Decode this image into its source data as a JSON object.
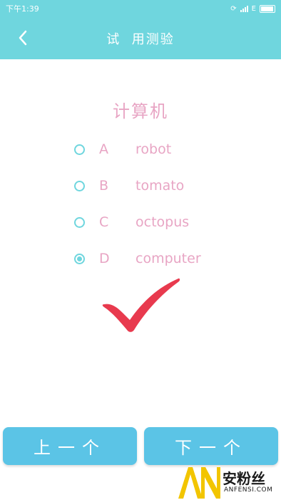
{
  "status_bar": {
    "time": "下午1:39",
    "network": "E"
  },
  "header": {
    "back_icon": "chevron-left-icon",
    "title": "试  用测验"
  },
  "question": {
    "word": "计算机"
  },
  "options": [
    {
      "letter": "A",
      "text": "robot",
      "selected": false
    },
    {
      "letter": "B",
      "text": "tomato",
      "selected": false
    },
    {
      "letter": "C",
      "text": "octopus",
      "selected": false
    },
    {
      "letter": "D",
      "text": "computer",
      "selected": true
    }
  ],
  "result": {
    "icon": "checkmark-icon",
    "color": "#e83a4e"
  },
  "footer": {
    "prev_label": "上一个",
    "next_label": "下一个"
  },
  "watermark": {
    "cn": "安粉丝",
    "en": "ANFENSI.COM"
  },
  "colors": {
    "accent": "#6fd6de",
    "button": "#5bc4e6",
    "text_pink": "#e8a5c4"
  }
}
